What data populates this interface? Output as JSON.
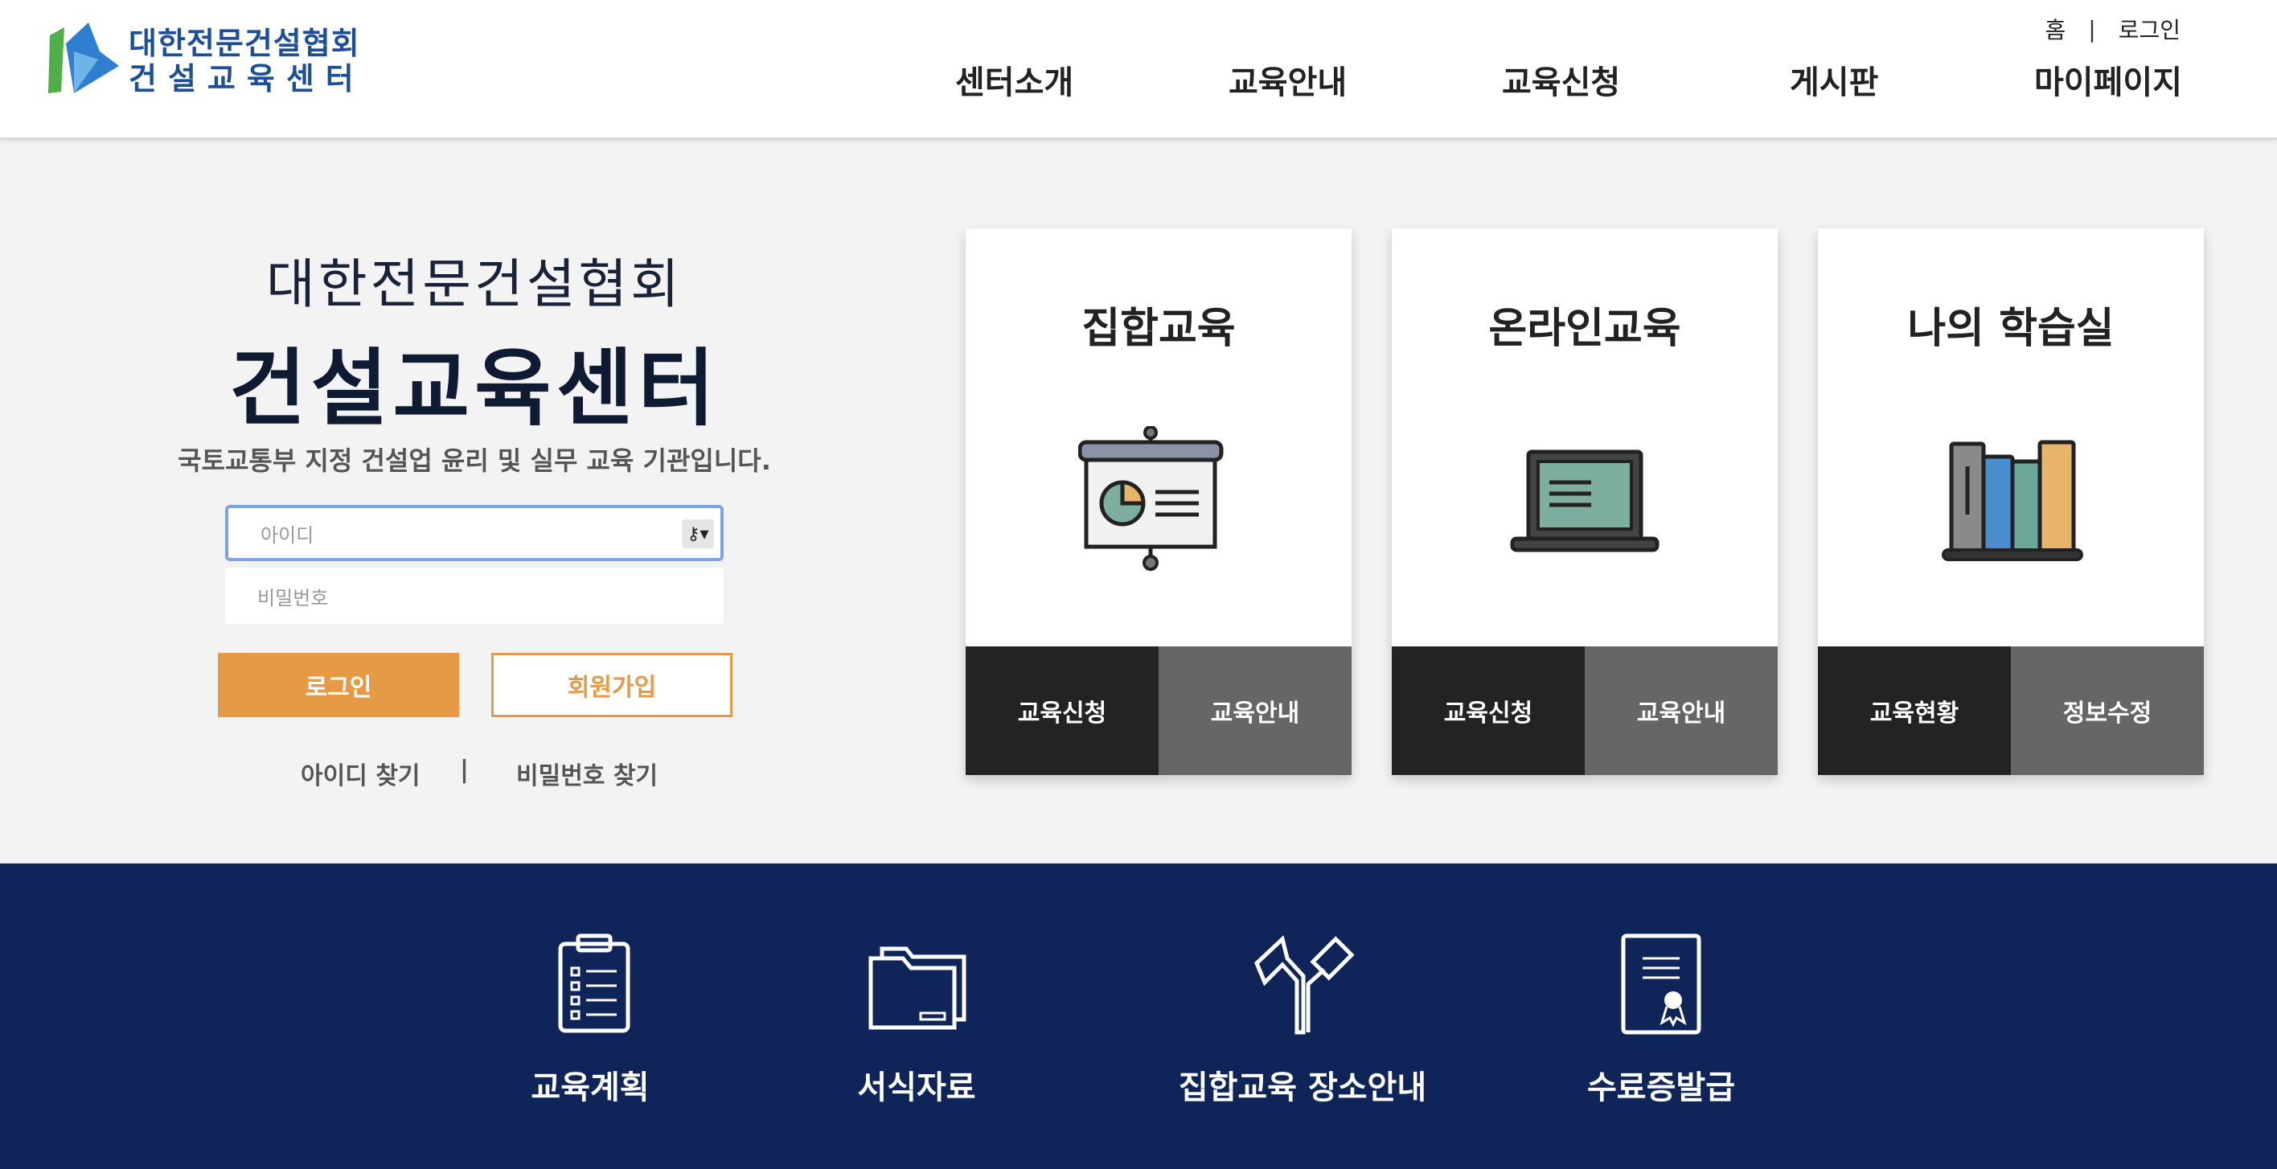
{
  "header": {
    "logo": {
      "line1": "대한전문건설협회",
      "line2": "건설교육센터"
    },
    "util": {
      "home": "홈",
      "separator": "|",
      "login": "로그인"
    },
    "nav": [
      "센터소개",
      "교육안내",
      "교육신청",
      "게시판",
      "마이페이지"
    ]
  },
  "hero": {
    "org_name": "대한전문건설협회",
    "center_name": "건설교육센터",
    "description": "국토교통부 지정 건설업 윤리 및 실무 교육 기관입니다."
  },
  "login_form": {
    "id_placeholder": "아이디",
    "pw_placeholder": "비밀번호",
    "login_button": "로그인",
    "join_button": "회원가입",
    "find_id": "아이디 찾기",
    "find_separator": "|",
    "find_pw": "비밀번호 찾기"
  },
  "cards": [
    {
      "title": "집합교육",
      "icon": "presentation-board-icon",
      "buttons": [
        "교육신청",
        "교육안내"
      ]
    },
    {
      "title": "온라인교육",
      "icon": "laptop-icon",
      "buttons": [
        "교육신청",
        "교육안내"
      ]
    },
    {
      "title": "나의 학습실",
      "icon": "books-icon",
      "buttons": [
        "교육현황",
        "정보수정"
      ]
    }
  ],
  "services": [
    {
      "label": "교육계획",
      "icon": "clipboard-icon"
    },
    {
      "label": "서식자료",
      "icon": "folder-icon"
    },
    {
      "label": "집합교육 장소안내",
      "icon": "road-sign-icon"
    },
    {
      "label": "수료증발급",
      "icon": "certificate-icon"
    }
  ],
  "colors": {
    "brand_blue": "#1d4f98",
    "band_navy": "#0f2459",
    "accent_orange": "#e69a45",
    "card_dark": "#232323",
    "card_gray": "#666666"
  }
}
